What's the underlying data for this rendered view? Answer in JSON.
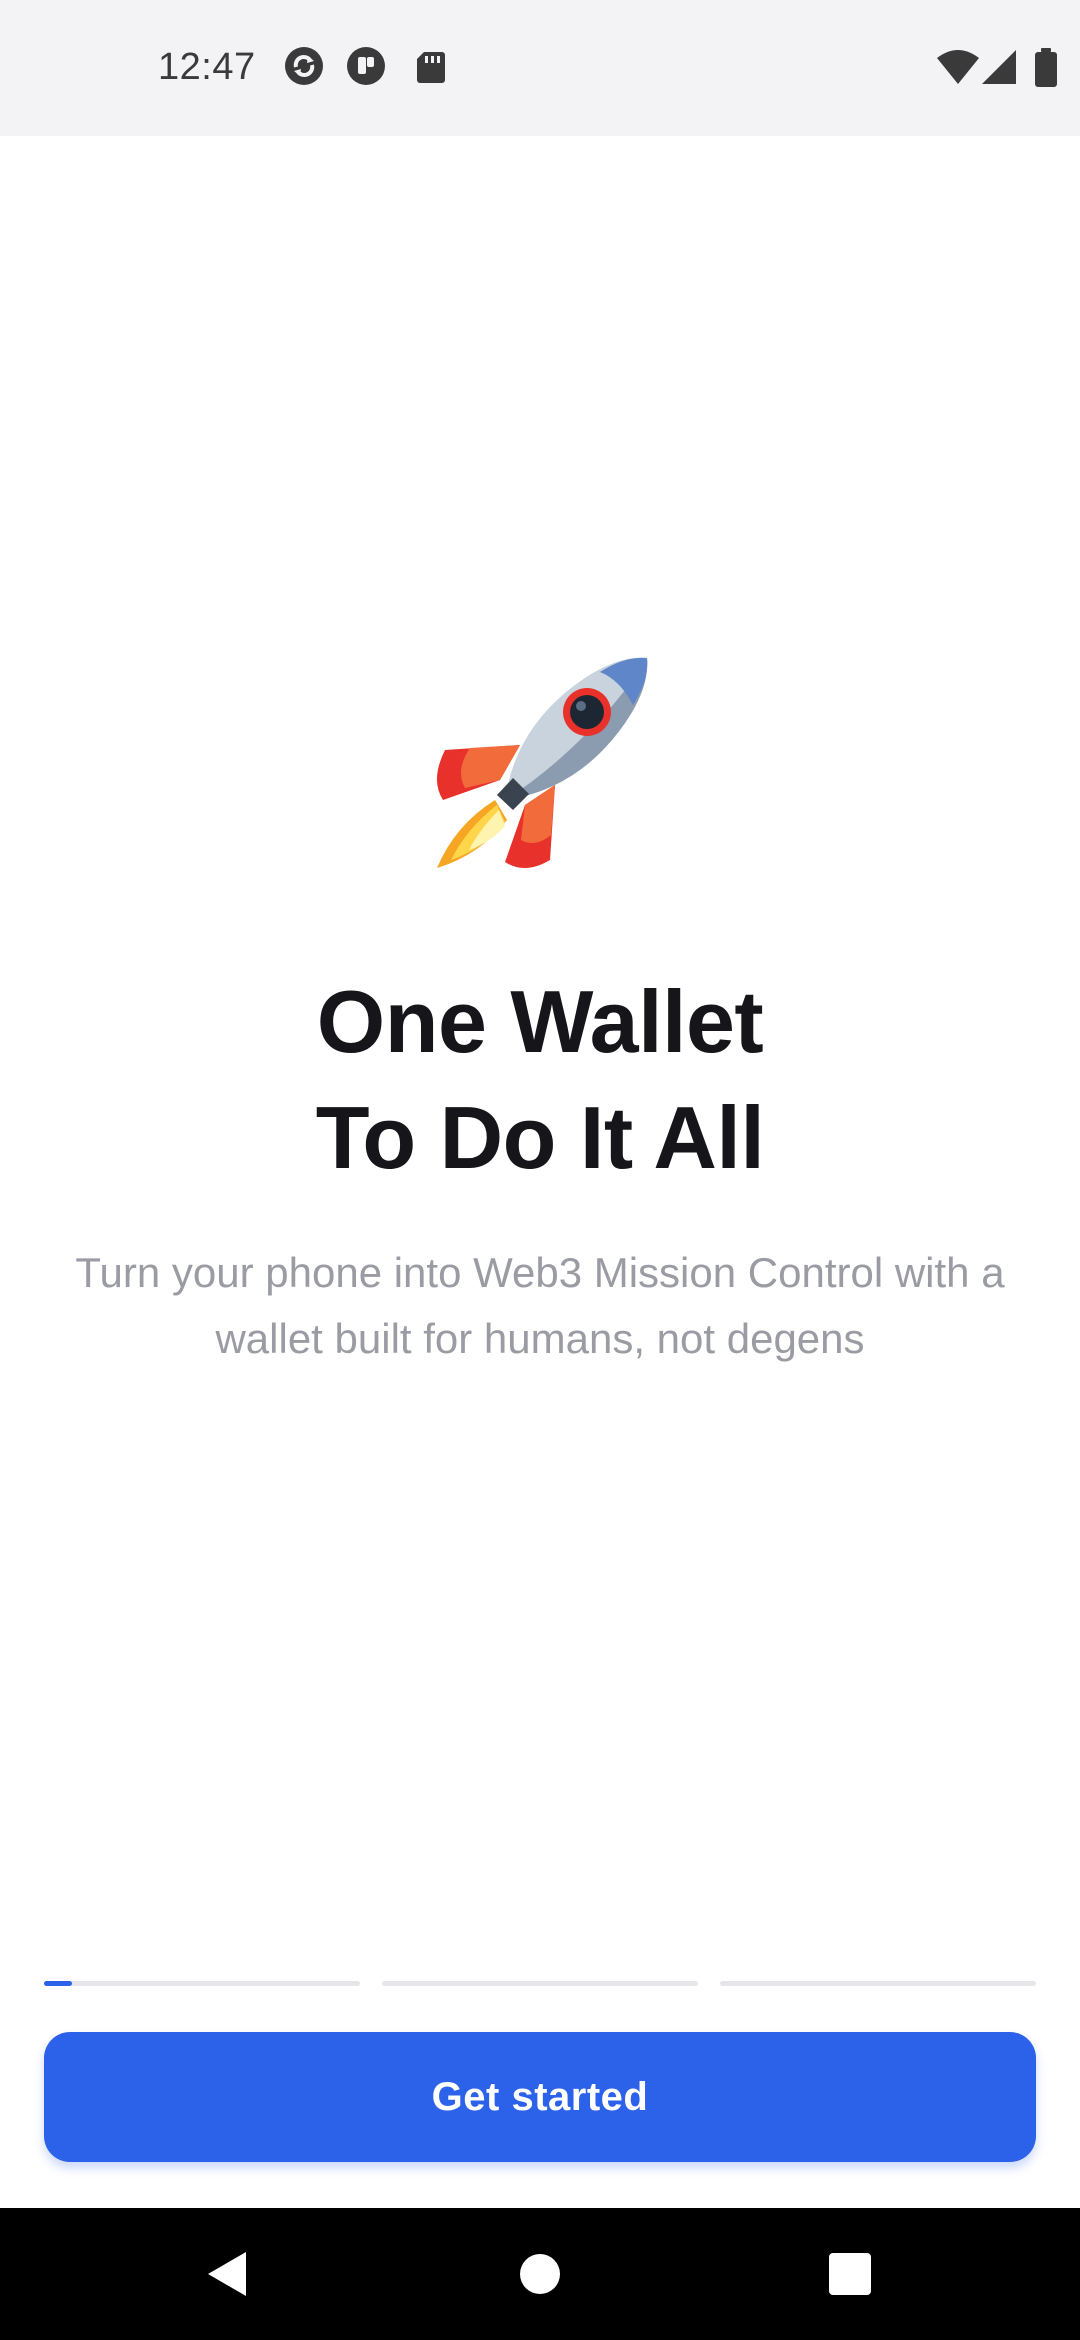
{
  "status_bar": {
    "time": "12:47",
    "left_icons": [
      "sync-icon",
      "notification-badge-icon",
      "sd-card-icon"
    ],
    "right_icons": [
      "wifi-icon",
      "cellular-signal-icon",
      "battery-icon"
    ]
  },
  "hero": {
    "emoji": "🚀",
    "title_line_1": "One Wallet",
    "title_line_2": "To Do It All",
    "subtitle": "Turn your phone into Web3 Mission Control with a wallet built for humans, not degens"
  },
  "progress": {
    "steps": 3,
    "current_step": 1,
    "current_fill_fraction": 0.09,
    "active_color": "#2c62ea",
    "track_color": "#e5e6ea"
  },
  "cta": {
    "label": "Get started",
    "color": "#2c62ea"
  },
  "nav_bar": {
    "buttons": [
      "back-icon",
      "home-icon",
      "recents-icon"
    ]
  }
}
